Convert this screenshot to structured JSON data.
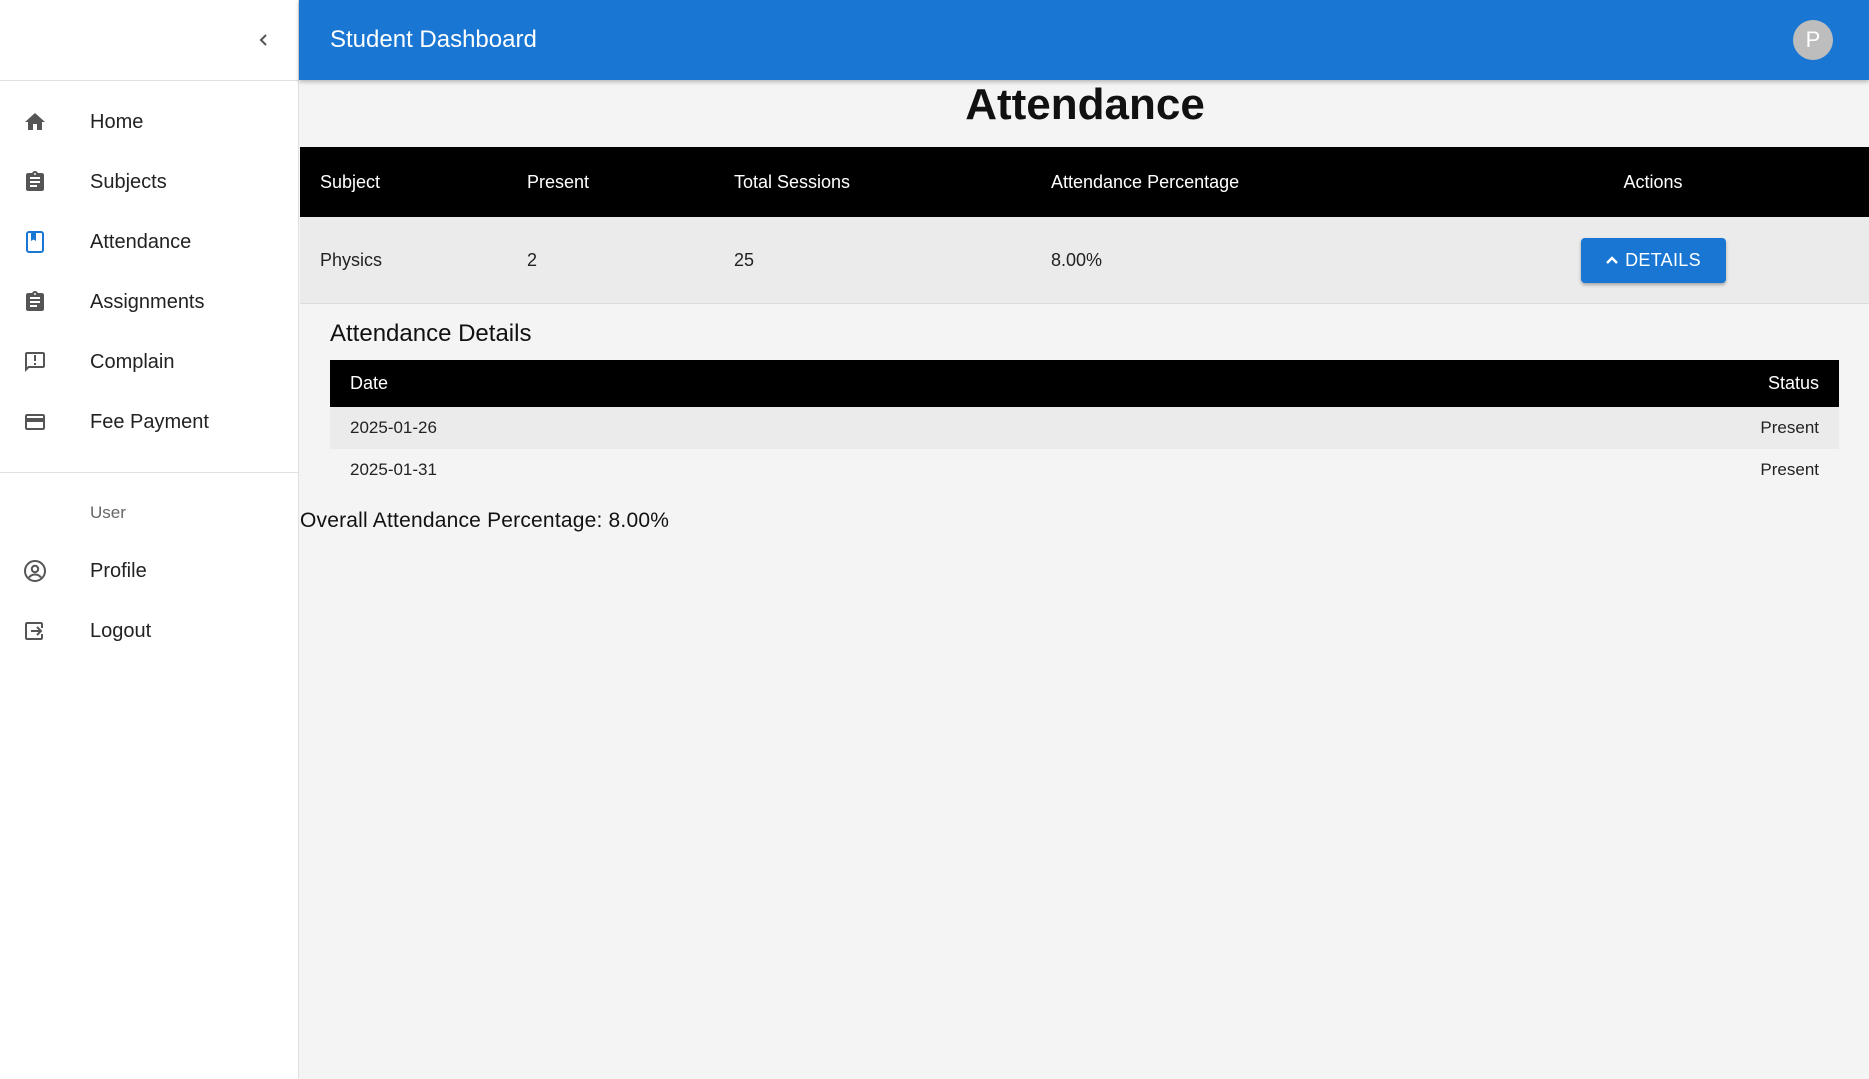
{
  "app": {
    "title": "Student Dashboard",
    "avatar_letter": "P"
  },
  "colors": {
    "primary": "#1976d2",
    "table_header": "#000000",
    "row_bg": "#ebebeb"
  },
  "sidebar": {
    "items": [
      {
        "label": "Home",
        "icon": "home-icon"
      },
      {
        "label": "Subjects",
        "icon": "clipboard-icon"
      },
      {
        "label": "Attendance",
        "icon": "bookmark-book-icon",
        "active": true
      },
      {
        "label": "Assignments",
        "icon": "clipboard-icon"
      },
      {
        "label": "Complain",
        "icon": "report-chat-icon"
      },
      {
        "label": "Fee Payment",
        "icon": "credit-card-icon"
      }
    ],
    "section_label": "User",
    "user_items": [
      {
        "label": "Profile",
        "icon": "account-circle-icon"
      },
      {
        "label": "Logout",
        "icon": "logout-icon"
      }
    ]
  },
  "main": {
    "title": "Attendance",
    "subject_table": {
      "headers": [
        "Subject",
        "Present",
        "Total Sessions",
        "Attendance Percentage",
        "Actions"
      ],
      "rows": [
        {
          "subject": "Physics",
          "present": "2",
          "total": "25",
          "percentage": "8.00%",
          "action_label": "DETAILS"
        }
      ]
    },
    "details": {
      "heading": "Attendance Details",
      "headers": [
        "Date",
        "Status"
      ],
      "rows": [
        {
          "date": "2025-01-26",
          "status": "Present"
        },
        {
          "date": "2025-01-31",
          "status": "Present"
        }
      ]
    },
    "overall": "Overall Attendance Percentage: 8.00%"
  }
}
